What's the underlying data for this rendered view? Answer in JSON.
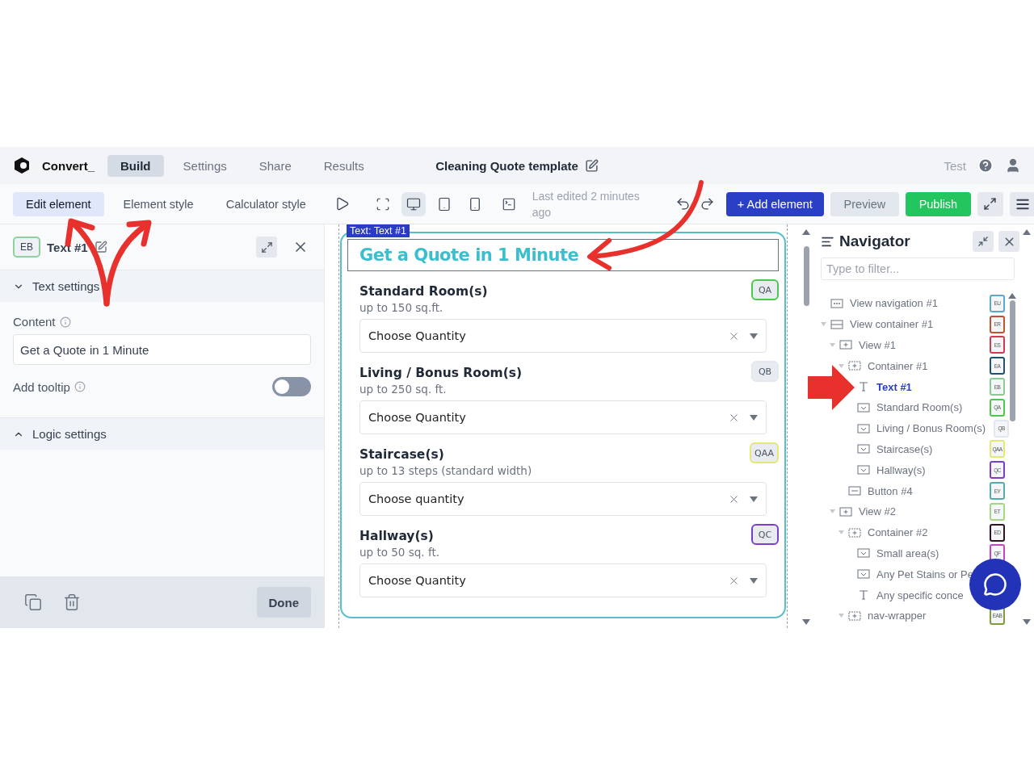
{
  "brand": "Convert_",
  "top_tabs": [
    {
      "label": "Build",
      "selected": true
    },
    {
      "label": "Settings",
      "selected": false
    },
    {
      "label": "Share",
      "selected": false
    },
    {
      "label": "Results",
      "selected": false
    }
  ],
  "document_title": "Cleaning Quote template",
  "user_label": "Test",
  "editor_tabs": [
    {
      "label": "Edit element",
      "selected": true
    },
    {
      "label": "Element style",
      "selected": false
    },
    {
      "label": "Calculator style",
      "selected": false
    }
  ],
  "devices": [
    {
      "kind": "desktop",
      "selected": true
    },
    {
      "kind": "tablet",
      "selected": false
    },
    {
      "kind": "phone",
      "selected": false
    }
  ],
  "last_edited": "Last edited 2 minutes ago",
  "actions": {
    "add": "+ Add element",
    "preview": "Preview",
    "publish": "Publish"
  },
  "element_panel": {
    "badge": "EB",
    "name": "Text #1",
    "done": "Done",
    "sections": [
      {
        "title": "Text settings",
        "expanded": true,
        "content_label": "Content",
        "content_value": "Get a Quote in 1 Minute",
        "tooltip_label": "Add tooltip",
        "tooltip_on": false
      },
      {
        "title": "Logic settings",
        "expanded": false
      }
    ]
  },
  "canvas": {
    "selection_label": "Text: Text #1",
    "heading": "Get a Quote in 1 Minute",
    "questions": [
      {
        "title": "Standard Room(s)",
        "subtitle": "up to 150 sq.ft.",
        "badge": "QA",
        "color": "#4cc94c",
        "value": "Choose Quantity"
      },
      {
        "title": "Living / Bonus Room(s)",
        "subtitle": "up to 250 sq. ft.",
        "badge": "QB",
        "color": "#e2e8f0",
        "value": "Choose Quantity"
      },
      {
        "title": "Staircase(s)",
        "subtitle": "up to 13 steps (standard width)",
        "badge": "QAA",
        "color": "#e4e872",
        "value": "Choose quantity"
      },
      {
        "title": "Hallway(s)",
        "subtitle": "up to 50 sq. ft.",
        "badge": "QC",
        "color": "#7a3fd0",
        "value": "Choose Quantity"
      }
    ]
  },
  "navigator": {
    "title": "Navigator",
    "filter_placeholder": "Type to filter...",
    "tree": [
      {
        "label": "View navigation #1",
        "kind": "nav",
        "badge": "EU",
        "color": "#5ba8cc",
        "selected": false
      },
      {
        "label": "View container #1",
        "kind": "stack",
        "badge": "ER",
        "color": "#c9502e",
        "selected": false,
        "expanded": true,
        "children": [
          {
            "label": "View #1",
            "kind": "view",
            "badge": "ES",
            "color": "#d23a52",
            "selected": false,
            "expanded": true,
            "children": [
              {
                "label": "Container #1",
                "kind": "container",
                "badge": "EA",
                "color": "#1f5270",
                "selected": false,
                "expanded": true,
                "children": [
                  {
                    "label": "Text #1",
                    "kind": "text",
                    "badge": "EB",
                    "color": "#86cc94",
                    "selected": true
                  },
                  {
                    "label": "Standard Room(s)",
                    "kind": "select",
                    "badge": "QA",
                    "color": "#4cc94c",
                    "selected": false
                  },
                  {
                    "label": "Living / Bonus Room(s)",
                    "kind": "select",
                    "badge": "QB",
                    "color": "#e2e8f0",
                    "selected": false
                  },
                  {
                    "label": "Staircase(s)",
                    "kind": "select",
                    "badge": "QAA",
                    "color": "#e4e872",
                    "selected": false
                  },
                  {
                    "label": "Hallway(s)",
                    "kind": "select",
                    "badge": "QC",
                    "color": "#7a3fd0",
                    "selected": false
                  }
                ]
              },
              {
                "label": "Button #4",
                "kind": "button",
                "badge": "EY",
                "color": "#4fb0a8",
                "selected": false
              }
            ]
          },
          {
            "label": "View #2",
            "kind": "view",
            "badge": "ET",
            "color": "#a2d882",
            "selected": false,
            "expanded": true,
            "children": [
              {
                "label": "Container #2",
                "kind": "container",
                "badge": "ED",
                "color": "#2e1424",
                "selected": false,
                "expanded": true,
                "children": [
                  {
                    "label": "Small area(s)",
                    "kind": "select",
                    "badge": "QF",
                    "color": "#c445c4",
                    "selected": false
                  },
                  {
                    "label": "Any Pet Stains or Pe",
                    "kind": "select",
                    "selected": false
                  },
                  {
                    "label": "Any specific conce",
                    "kind": "text",
                    "selected": false
                  }
                ]
              },
              {
                "label": "nav-wrapper",
                "kind": "container",
                "badge": "EAB",
                "color": "#7f9c3e",
                "selected": false,
                "expanded": true
              }
            ]
          }
        ]
      }
    ]
  }
}
